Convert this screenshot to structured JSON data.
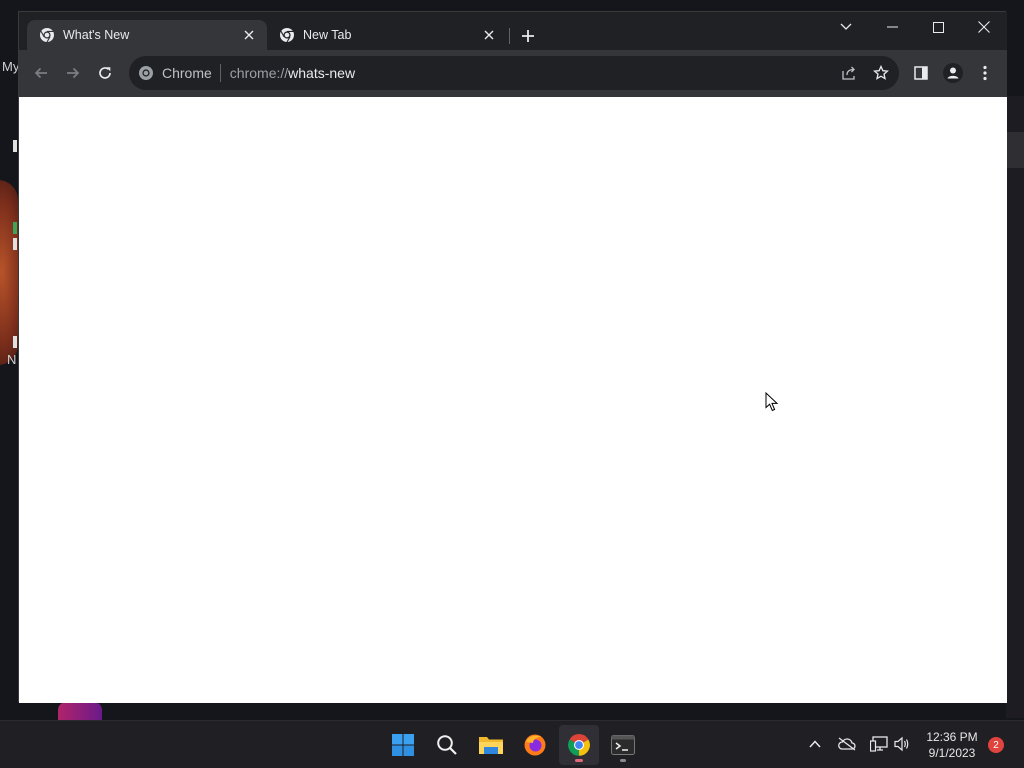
{
  "desktop": {
    "label_top": "My",
    "label_mid": "N"
  },
  "browser": {
    "tabs": [
      {
        "title": "What's New",
        "active": true
      },
      {
        "title": "New Tab",
        "active": false
      }
    ],
    "omnibox": {
      "chip": "Chrome",
      "url_scheme": "chrome://",
      "url_host": "whats-new"
    }
  },
  "taskbar": {
    "apps": [
      {
        "name": "start",
        "icon": "windows-logo-icon"
      },
      {
        "name": "search",
        "icon": "search-icon"
      },
      {
        "name": "file-explorer",
        "icon": "folder-icon"
      },
      {
        "name": "firefox",
        "icon": "firefox-icon"
      },
      {
        "name": "chrome",
        "icon": "chrome-icon",
        "active": true
      },
      {
        "name": "terminal",
        "icon": "terminal-icon"
      }
    ],
    "clock": {
      "time": "12:36 PM",
      "date": "9/1/2023"
    },
    "notifications": "2"
  },
  "colors": {
    "titlebar": "#202124",
    "toolbar": "#35363a",
    "omnibox": "#202124",
    "taskbar": "#1f1f24",
    "badge": "#e0443e"
  }
}
